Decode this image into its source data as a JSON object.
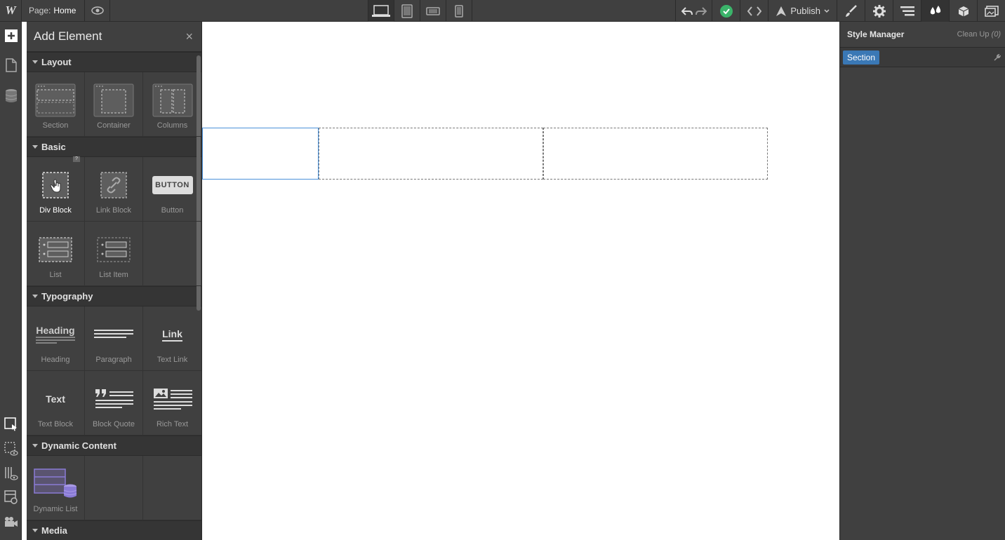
{
  "topbar": {
    "logo": "W",
    "page_prefix": "Page:",
    "page_name": "Home",
    "publish_label": "Publish"
  },
  "panel": {
    "title": "Add Element",
    "close": "×",
    "categories": [
      {
        "name": "Layout",
        "items": [
          "Section",
          "Container",
          "Columns"
        ]
      },
      {
        "name": "Basic",
        "items": [
          "Div Block",
          "Link Block",
          "Button",
          "List",
          "List Item"
        ]
      },
      {
        "name": "Typography",
        "items": [
          "Heading",
          "Paragraph",
          "Text Link",
          "Text Block",
          "Block Quote",
          "Rich Text"
        ]
      },
      {
        "name": "Dynamic Content",
        "items": [
          "Dynamic List"
        ]
      },
      {
        "name": "Media",
        "items": []
      }
    ],
    "icon_text": {
      "button": "BUTTON",
      "heading": "Heading",
      "link": "Link",
      "text": "Text"
    },
    "qmark": "?"
  },
  "style_manager": {
    "title": "Style Manager",
    "clean_up": "Clean Up",
    "clean_count": "(0)",
    "selected_tag": "Section"
  },
  "colors": {
    "dark_bg": "#404040",
    "accent": "#3a78b5",
    "success": "#3bb46a",
    "dynamic": "#8a7bd6"
  }
}
